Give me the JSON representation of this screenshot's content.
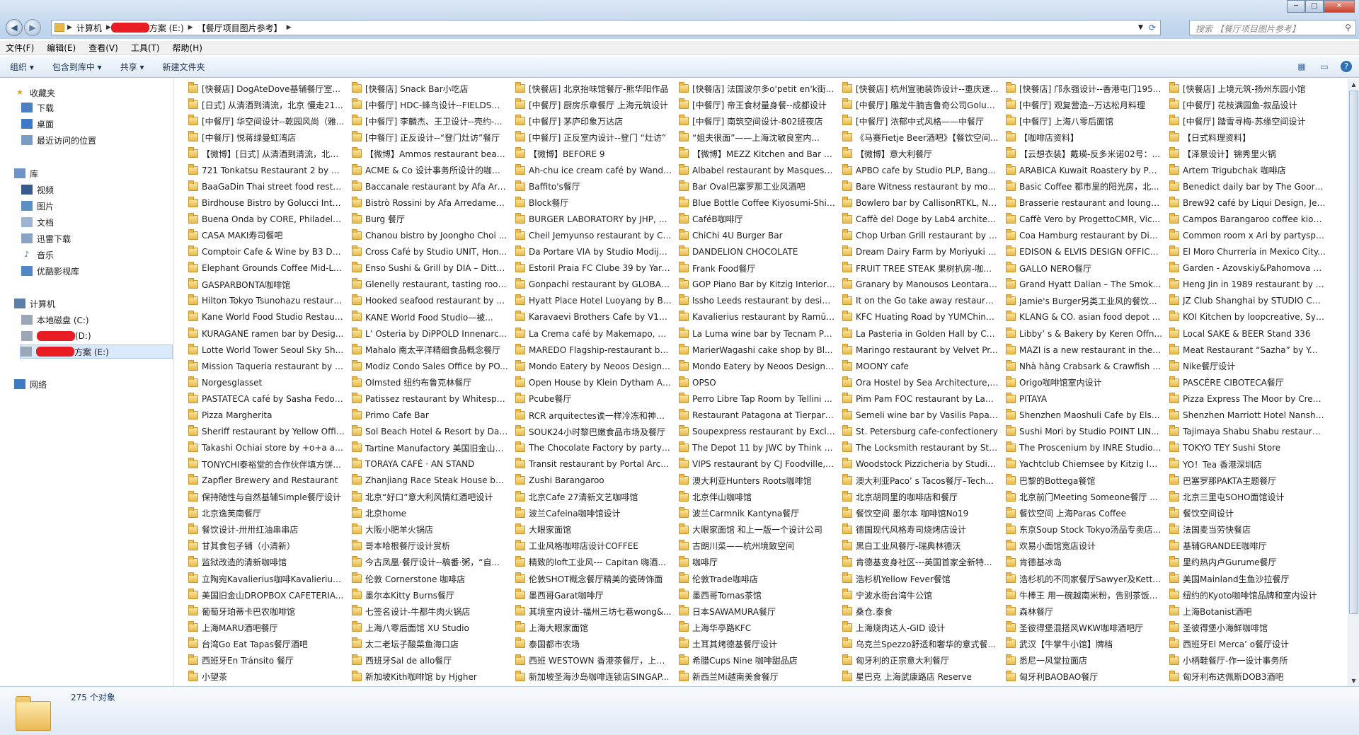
{
  "window": {
    "breadcrumb": [
      "计算机",
      "方案 (E:)",
      "【餐厅项目图片参考】"
    ],
    "search_placeholder": "搜索 【餐厅项目图片参考】",
    "controls": [
      "minimize",
      "maximize",
      "close"
    ]
  },
  "menu": [
    "文件(F)",
    "编辑(E)",
    "查看(V)",
    "工具(T)",
    "帮助(H)"
  ],
  "toolbar": {
    "organize": "组织 ▾",
    "include": "包含到库中 ▾",
    "share": "共享 ▾",
    "new_folder": "新建文件夹"
  },
  "nav": {
    "favorites": {
      "title": "收藏夹",
      "items": [
        "下载",
        "桌面",
        "最近访问的位置"
      ]
    },
    "libraries": {
      "title": "库",
      "items": [
        "视频",
        "图片",
        "文档",
        "迅雷下载",
        "音乐",
        "优酷影视库"
      ]
    },
    "computer": {
      "title": "计算机",
      "drives": [
        "本地磁盘 (C:)",
        "(D:)",
        "方案 (E:)"
      ]
    },
    "network": "网络"
  },
  "status": {
    "count": "275 个对象"
  },
  "columns": [
    [
      "[快餐店] DogAteDove基辅餐厅室...",
      "[日式] 从清酒到清流，北京 慢走21...",
      "[中餐厅] 华空间设计--乾园风尚（雅...",
      "[中餐厅] 悦蒋绿曼虹湾店",
      "【微博】[日式] 从清酒到清流，北京...",
      "721 Tonkatsu Restaurant 2 by G...",
      "BaaGaDin Thai street food resta...",
      "Birdhouse Bistro by Golucci Inter...",
      "Buena Onda by CORE, Philadelp...",
      "CASA MAKI寿司餐吧",
      "Comptoir Cafe & Wine by B3 De...",
      "Elephant Grounds Coffee Mid-Le...",
      "GASPARBONTA咖啡馆",
      "Hilton Tokyo Tsunohazu restaura...",
      "Kane World Food Studio Restaur...",
      "KURAGANE ramen bar by Desig...",
      "Lotte World Tower Seoul Sky Sh...",
      "Mission Taqueria restaurant by C...",
      "Norgesglasset",
      "PASTATECA café by Sasha Fedor...",
      "Pizza Margherita",
      "Sheriff restaurant by Yellow Offic...",
      "Takashi Ochiai store by +o+a ar...",
      "TONYCHI泰裕堂的合作伙伴填方饼...",
      "Zapfler Brewery and Restaurant",
      "保持随性与自然基辅Simple餐厅设计",
      "北京逸芙南餐厅",
      "餐饮设计-卅卅红油串串店",
      "甘其食包子铺（小清新）",
      "监狱改造的清新咖啡馆",
      "立陶宛Kavalierius咖啡Kavalierius ...",
      "美国旧金山DROPBOX CAFETERIA...",
      "葡萄牙珀蒂卡巴农咖啡馆",
      "上海MARU酒吧餐厅",
      "台湾Go Eat Tapas餐厅酒吧",
      "西班牙En Tránsito 餐厅",
      "小望茶"
    ],
    [
      "[快餐店] Snack Bar小吃店",
      "[中餐厅] HDC-蜂鸟设计--FIELDS十域",
      "[中餐厅] 李麟杰、王卫设计--壳约-...",
      "[中餐厅] 正反设计--“登门灶访”餐厅",
      "【微博】Ammos restaurant beac...",
      "ACME & Co 设计事务所设计的咖啡...",
      "Baccanale restaurant by Afa Arre...",
      "Bistrò Rossini by Afa Arredament...",
      "Burg 餐厅",
      "Chanou bistro by Joongho Choi ...",
      "Cross Café by Studio UNIT, Hon...",
      "Enso Sushi & Grill by DIA – Dittel...",
      "Glenelly restaurant, tasting room...",
      "Hooked seafood restaurant by H...",
      "KANE World Food Studio—被...",
      "L’ Osteria by DiPPOLD Innenarc...",
      "Mahalo 南太平洋精细食品概念餐厅",
      "Modiz Condo Sales Office by PO...",
      "Olmsted 纽约布鲁克林餐厅",
      "Patissez restaurant by Whitespac...",
      "Primo Cafe Bar",
      "Sol Beach Hotel & Resort by Dae...",
      "Tartine Manufactory 美国旧金山面...",
      "TORAYA CAFÉ · AN STAND",
      "Zhanjiang Race Steak House by ...",
      "北京“好口”意大利风情红酒吧设计",
      "北京home",
      "大阪小肥羊火锅店",
      "哥本哈根餐厅设计赏析",
      "今古凤凰·餐厅设计--稿番·粥，“自...",
      "伦敦 Cornerstone 咖啡店",
      "墨尔本Kitty Burns餐厅",
      "七签名设计-牛都牛肉火锅店",
      "上海八零后面馆  XU Studio",
      "太二老坛子酸菜鱼海口店",
      "西班牙Sal de allo餐厅",
      "新加坡Kith咖啡馆 by Hjgher"
    ],
    [
      "[快餐店] 北京抬味馆餐厅-熊华阳作品",
      "[中餐厅] 厨房乐章餐厅  上海元筑设计",
      "[中餐厅] 茅庐印象万达店",
      "[中餐厅] 正反室内设计--登门 “灶访”",
      "【微博】BEFORE 9",
      "Ah-chu ice cream café by Wande...",
      "Baffito's餐厅",
      "Block餐厅",
      "BURGER LABORATORY by JHP, S...",
      "Cheil Jemyunso restaurant by CJ ...",
      "Da Portare VIA by Studio Modije...",
      "Estoril Praia FC Clube 39 by Yaro...",
      "Gonpachi restaurant by GLOBAL-...",
      "Hyatt Place Hotel Luoyang by BL...",
      "Karavaevi Brothers Cafe by V12, ...",
      "La Crema café by Makemapo, D...",
      "MAREDO Flagship-restaurant by ...",
      "Mondo Eatery by Neoos Design ...",
      "Open House by Klein Dytham Ar...",
      "Pcube餐厅",
      "RCR arquitectes诶一样冷冻和神秘...",
      "SOUK24小时黎巴嫩食品市场及餐厅",
      "The Chocolate Factory by partys...",
      "Transit restaurant by Portal Archi...",
      "Zushi Barangaroo",
      "北京Cafe 27清新文艺咖啡馆",
      "波兰Cafeina咖啡馆设计",
      "大眼家面馆",
      "工业风格咖啡店设计COFFEE",
      "精致的loft工业风--- Capitan 嗨酒...",
      "伦敦SHOT概念餐厅精美的瓷砖饰面",
      "墨西哥Garat咖啡厅",
      "其境室内设计-福州三坊七巷wong&...",
      "上海大眼家面馆",
      "泰国都市农场",
      "西班 WESTOWN 香港茶餐厅，上海...",
      "新加坡圣海沙岛咖啡连锁店SINGAP..."
    ],
    [
      "[快餐店] 法国波尔多o'petit en'k街...",
      "[中餐厅] 帝王食材量身餐--成都设计",
      "[中餐厅] 南筑空间设计-802班夜店",
      "“姐夫很面”——上海沈敏良室内...",
      "【微博】MEZZ Kitchen and Bar b...",
      "Albabel restaurant by Masquesp...",
      "Bar Oval巴塞罗那工业风酒吧",
      "Blue Bottle Coffee Kiyosumi-Shir...",
      "CaféB咖啡厅",
      "ChiChi 4U Burger Bar",
      "DANDELION CHOCOLATE",
      "Frank Food餐厅",
      "GOP Piano Bar by Kitzig Interior ...",
      "Issho Leeds restaurant by design...",
      "Kavalierius restaurant by Ramūn...",
      "La Luma wine bar by Tecnam Pro...",
      "MarierWagashi cake shop by Bl...",
      "Mondo Eatery by Neoos Design,...",
      "OPSO",
      "Perro Libre Tap Room by Tellini ...",
      "Restaurant Patagona at Tierpark ...",
      "Soupexpress restaurant by Exclai...",
      "The Depot 11 by JWC by Think A...",
      "VIPS restaurant by CJ Foodville, ...",
      "澳大利亚Hunters Roots咖啡馆",
      "北京伴山咖啡馆",
      "波兰Carmnik Kantyna餐厅",
      "大眼家面馆 和上一版一个设计公司",
      "古朗川菜——杭州境致空间",
      "咖啡厅",
      "伦敦Trade咖啡店",
      "墨西哥Tomas茶馆",
      "日本SAWAMURA餐厅",
      "上海华亭路KFC",
      "土耳其烤德基餐厅设计",
      "希腊Cups Nine 咖啡甜品店",
      "新西兰Mi越南美食餐厅"
    ],
    [
      "[快餐店] 杭州宣驰装饰设计--重庆速...",
      "[中餐厅] 雕龙牛腩吉鲁奇公司Goluc...",
      "[中餐厅] 浓郁中式风格——中餐厅",
      "《马赛Fietje Beer酒吧》【餐饮空间...",
      "【微博】意大利餐厅",
      "APBO cafe by Studio PLP, Bangk...",
      "Bare Witness restaurant by moM...",
      "Bowlero bar by CallisonRTKL, No...",
      "Caffè del Doge by Lab4 architect...",
      "Chop Urban Grill restaurant by T...",
      "Dream Dairy Farm by Moriyuki O...",
      "FRUIT TREE STEAK 果树扒房-咖餐_...",
      "Granary by Manousos Leontarak...",
      "It on the Go take away restauran...",
      "KFC Huating Road by YUMChina,...",
      "La Pasteria in Golden Hall by Cha...",
      "Maringo restaurant by Velvet Pr...",
      "MOONY cafe",
      "Ora Hostel by Sea Architecture, ...",
      "Pim Pam FOC restaurant by Lagr...",
      "Semeli wine bar by Vasilis Papad...",
      "St. Petersburg cafe-confectionery",
      "The Locksmith restaurant by Stu...",
      "Woodstock Pizzicheria by Studio...",
      "澳大利亚Paco’ s Tacos餐厅–Tech...",
      "北京胡同里的咖啡店和餐厅",
      "餐饮空间  墨尔本 咖啡馆No19",
      "德国现代风格寿司烧烤店设计",
      "黑白工业风餐厅-瑞典林德沃",
      "肯德基变身社区---英国首家全新特...",
      "浩杉机Yellow Fever餐馆",
      "宁波水街台湾牛公馆",
      "桑仓.泰食",
      "上海烧肉达人-GID 设计",
      "乌克兰Spezzo舒适和奢华的意式餐...",
      "匈牙利的正宗意大利餐厅",
      "星巴克 上海武康路店 Reserve"
    ],
    [
      "[快餐店] 邝永强设计--香港屯门195...",
      "[中餐厅] 观复营造--万达松月料理",
      "[中餐厅] 上海八零后面馆",
      "【咖啡店资料】",
      "【云想衣装】戴瑛-反多米诺02号：...",
      "ARABICA Kuwait Roastery by Pud...",
      "Basic Coffee 都市里的阳光房，北...",
      "Brasserie restaurant and lounge ...",
      "Caffè Vero by ProgettoCMR, Vic...",
      "Coa Hamburg restaurant by DiPP...",
      "EDISON & ELVIS DESIGN OFFICE...",
      "GALLO NERO餐厅",
      "Grand Hyatt Dalian – The Smoke ...",
      "Jamie's Burger另类工业风的餐饮...",
      "KLANG & CO. asian food depot ...",
      "Libby’ s & Bakery by Keren Offn...",
      "MAZI is a new restaurant in the h...",
      "Nhà hàng Crabsark & Crawfish R...",
      "Origo咖啡馆室内设计",
      "PITAYA",
      "Shenzhen Maoshuli Cafe by Else...",
      "Sushi Mori by Studio POINT LIN...",
      "The Proscenium by INRE Studio, ...",
      "Yachtclub Chiemsee by Kitzig Int...",
      "巴黎的Bottega餐馆",
      "北京前门Meeting Someone餐厅 ...",
      "餐饮空间  上海Paras Coffee",
      "东京Soup Stock Tokyo汤品专卖店...",
      "欢易小面馆宽店设计",
      "肯德基冰岛",
      "浩杉机的不同家餐厅Sawyer及Kettle ...",
      "牛棒王 用一碗越南米粉，告别茶饭...",
      "森林餐厅",
      "圣彼得堡混搭风WKW咖啡酒吧厅",
      "武汉【牛掌牛小馆】牌档",
      "悉尼一风堂拉面店",
      "匈牙利BAOBAO餐厅"
    ],
    [
      "[快餐店] 上境元筑-扬州东园小馆",
      "[中餐厅] 花枝满园鱼-叙品设计",
      "[中餐厅] 踏雪寻梅-苏缘空间设计",
      "【日式料理资料】",
      "【泽景设计】锦秀里火锅",
      "Artem Trigubchak 咖啡店",
      "Benedict daily bar by The Goort, ...",
      "Brew92 café by Liqui Design, Jed...",
      "Campos Barangaroo coffee kios...",
      "Common room x Ari by partyspa...",
      "El Moro Churrería in Mexico City...",
      "Garden - Azovskiy&Pahomova ar...",
      "Heng Jin in 1989 restaurant by T...",
      "JZ Club Shanghai by STUDIO C8, ...",
      "KOI Kitchen by loopcreative, Syd...",
      "Local SAKE & BEER Stand 336",
      "Meat Restaurant “Sazha” by Y...",
      "Nike餐厅设计",
      "PASCÈRE CIBOTECA餐厅",
      "Pizza Express The Moor by Cree...",
      "Shenzhen Marriott Hotel Nansha...",
      "Tajimaya Shabu Shabu restauran...",
      "TOKYO TEY Sushi Store",
      "YO！Tea 香港深圳店",
      "巴塞罗那PAKTA主题餐厅",
      "北京三里屯SOHO面馆设计",
      "餐饮空间设计",
      "法国麦当劳快餐店",
      "基辅GRANDEE咖啡厅",
      "里约热内卢Gurume餐厅",
      "美国Mainland生鱼沙拉餐厅",
      "纽约的Kyoto咖啡馆品牌和室内设计",
      "上海Botanist酒吧",
      "圣彼得堡小海鲜咖啡馆",
      "西班牙El Merca’ o餐厅设计",
      "小柄鞋餐厅-作一设计事务所",
      "匈牙利布达佩斯DOB3酒吧"
    ]
  ]
}
